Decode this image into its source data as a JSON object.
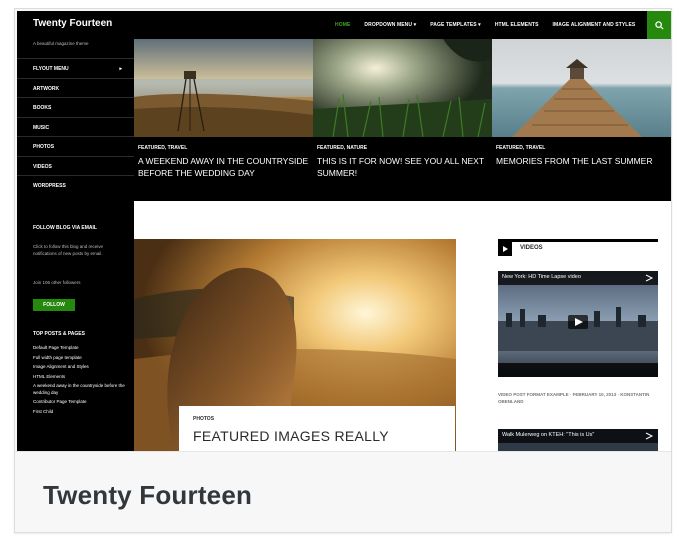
{
  "site": {
    "title": "Twenty Fourteen",
    "tagline": "A beautiful magazine theme"
  },
  "nav": {
    "items": [
      "HOME",
      "DROPDOWN MENU ▾",
      "PAGE TEMPLATES ▾",
      "HTML ELEMENTS",
      "IMAGE ALIGNMENT AND STYLES"
    ],
    "active_color": "#41a62a"
  },
  "sidebar": {
    "menu": [
      "FLYOUT MENU",
      "ARTWORK",
      "BOOKS",
      "MUSIC",
      "PHOTOS",
      "VIDEOS",
      "WORDPRESS"
    ],
    "follow_title": "FOLLOW BLOG VIA EMAIL",
    "follow_text": "Click to follow this blog and receive notifications of new posts by email.",
    "followers_text": "Join 106 other followers",
    "follow_button": "FOLLOW",
    "top_posts_title": "TOP POSTS & PAGES",
    "top_posts": [
      "Default Page Template",
      "Full width page template",
      "Image Alignment and Styles",
      "HTML Elements",
      "A weekend away in the countryside before the wedding day",
      "Contributor Page Template",
      "First Child"
    ]
  },
  "featured": [
    {
      "category": "FEATURED, TRAVEL",
      "title": "A WEEKEND AWAY IN THE COUNTRYSIDE BEFORE THE WEDDING DAY"
    },
    {
      "category": "FEATURED, NATURE",
      "title": "THIS IS IT FOR NOW! SEE YOU ALL NEXT SUMMER!"
    },
    {
      "category": "FEATURED, TRAVEL",
      "title": "MEMORIES FROM THE LAST SUMMER"
    }
  ],
  "post": {
    "category": "PHOTOS",
    "title": "FEATURED IMAGES REALLY"
  },
  "videos_widget": {
    "title": "VIDEOS",
    "video1_title": "New York: HD Time Lapse video",
    "video1_meta": "VIDEO POST FORMAT EXAMPLE · FEBRUARY 10, 2013 · KONSTANTIN OBENLAND",
    "video2_title": "Walk Mulerweg on KTEH: \"This is Us\""
  },
  "caption": {
    "theme_name": "Twenty Fourteen"
  },
  "colors": {
    "accent": "#24890d",
    "header_bg": "#000000"
  }
}
